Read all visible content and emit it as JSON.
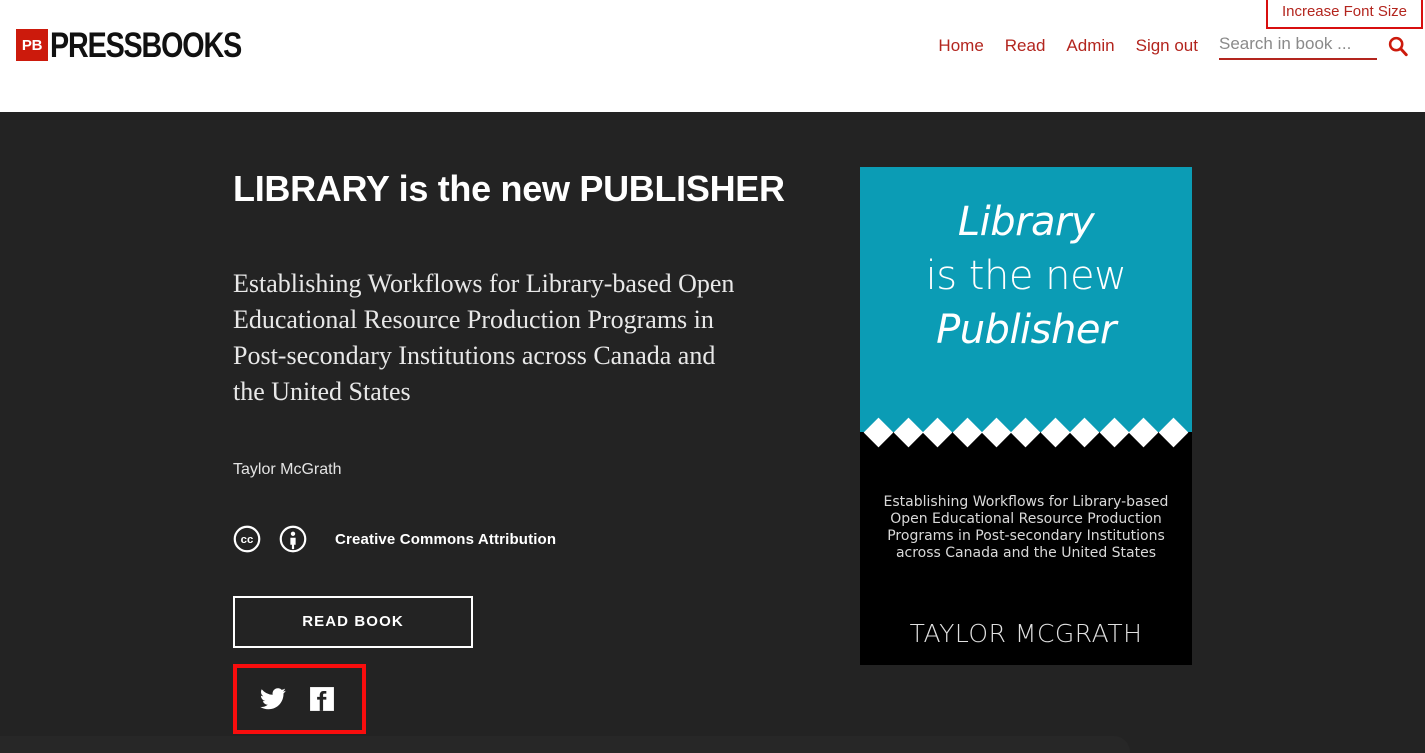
{
  "header": {
    "logo": {
      "mark_text": "PB",
      "word_text": "PRESSBOOKS",
      "mark_bg": "#cc1a0c"
    },
    "nav": [
      {
        "label": "Home",
        "name": "nav-link-home"
      },
      {
        "label": "Read",
        "name": "nav-link-read"
      },
      {
        "label": "Admin",
        "name": "nav-link-admin"
      },
      {
        "label": "Sign out",
        "name": "nav-link-sign-out"
      }
    ],
    "search": {
      "placeholder": "Search in book ...",
      "value": "",
      "icon": "search-icon"
    },
    "font_size_control": {
      "label": "Increase Font Size",
      "border_color": "#d80f0f"
    },
    "accent_color": "#b3251e"
  },
  "hero": {
    "title": "LIBRARY is the new PUBLISHER",
    "subtitle": "Establishing Workflows for Library-based Open Educational Resource Production Programs in Post-secondary Institutions across Canada and the United States",
    "author": "Taylor McGrath",
    "license": {
      "name": "Creative Commons Attribution",
      "icons": [
        "creative-commons-icon",
        "attribution-by-icon"
      ]
    },
    "read_book_label": "READ BOOK",
    "share": {
      "highlight_color": "#f80d0d",
      "links": [
        {
          "label": "Share on Twitter",
          "icon": "twitter-icon"
        },
        {
          "label": "Share on Facebook",
          "icon": "facebook-icon"
        }
      ]
    },
    "background_color": "#232323"
  },
  "cover": {
    "top_bg": "#0b9cb5",
    "bottom_bg": "#000000",
    "line1": "Library",
    "line2": "is the new",
    "line3": "Publisher",
    "diamond_count": 11,
    "subtitle": "Establishing Workflows for Library-based Open Educational Resource Production Programs in Post-secondary Institutions across Canada and the United States",
    "author": "TAYLOR MCGRATH"
  }
}
